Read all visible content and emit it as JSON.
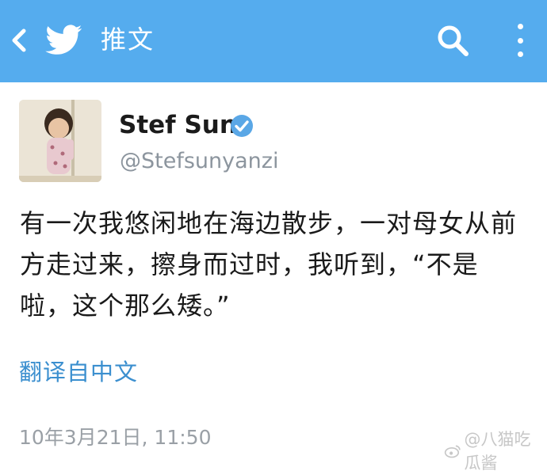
{
  "header": {
    "title": "推文",
    "back_icon": "back-arrow-icon",
    "logo_icon": "twitter-bird-icon",
    "search_icon": "search-icon",
    "more_icon": "more-vertical-icon",
    "background_color": "#55acee"
  },
  "tweet": {
    "display_name": "Stef Sun",
    "verified": true,
    "handle": "@Stefsunyanzi",
    "text": "有一次我悠闲地在海边散步，一对母女从前方走过来，擦身而过时，我听到，“不是啦，这个那么矮。”",
    "translate_label": "翻译自中文",
    "timestamp": "10年3月21日, 11:50"
  },
  "watermark": {
    "text": "@八猫吃瓜酱"
  },
  "colors": {
    "link": "#3b8fcf",
    "muted": "#8c959e",
    "verified": "#5aa7e6"
  }
}
